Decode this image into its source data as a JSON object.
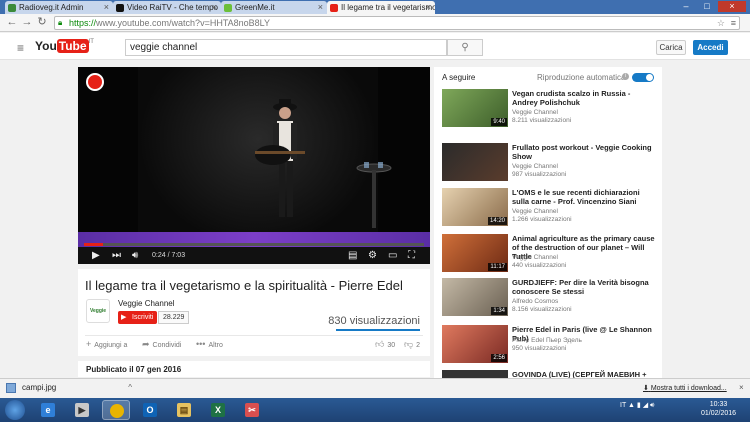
{
  "browser": {
    "tabs": [
      {
        "label": "Radioveg.it Admin",
        "icon_color": "#3a8a3a"
      },
      {
        "label": "Video RaiTV - Che tempo",
        "icon_color": "#111111"
      },
      {
        "label": "GreenMe.it",
        "icon_color": "#6cbf3a"
      },
      {
        "label": "Il legame tra il vegetarismo",
        "icon_color": "#e62117",
        "active": true
      }
    ],
    "url_https": "https://",
    "url_rest": "www.youtube.com/watch?v=HHTA8noB8LY"
  },
  "youtube": {
    "logo_you": "You",
    "logo_tube": "Tube",
    "logo_region": "IT",
    "search_value": "veggie channel",
    "upload_label": "Carica",
    "signin_label": "Accedi"
  },
  "player": {
    "time": "0:24 / 7:03",
    "progress_fraction": 0.057
  },
  "video": {
    "title": "Il legame tra il vegetarismo e la spiritualità - Pierre Edel",
    "channel_name": "Veggie Channel",
    "channel_logo_text": "Veggie",
    "subscribe_label": "Iscriviti",
    "subscriber_count": "28.229",
    "views": "830 visualizzazioni",
    "actions": {
      "add_to": "Aggiungi a",
      "share": "Condividi",
      "more": "Altro",
      "likes": "30",
      "dislikes": "2"
    },
    "published": "Pubblicato il 07 gen 2016"
  },
  "sidebar": {
    "next_label": "A seguire",
    "autoplay_label": "Riproduzione automatica",
    "autoplay_on": true,
    "items": [
      {
        "title": "Vegan crudista scalzo in Russia - Andrey Polishchuk",
        "channel": "Veggie Channel",
        "views": "8.211 visualizzazioni",
        "duration": "9:40",
        "thumb": "#6b8e4e"
      },
      {
        "title": "Frullato post workout - Veggie Cooking Show",
        "channel": "Veggie Channel",
        "views": "987 visualizzazioni",
        "duration": "",
        "thumb": "#3a3a3a"
      },
      {
        "title": "L'OMS e le sue recenti dichiarazioni sulla carne - Prof. Vincenzino Siani",
        "channel": "Veggie Channel",
        "views": "1.266 visualizzazioni",
        "duration": "14:20",
        "thumb": "#c9a77a"
      },
      {
        "title": "Animal agriculture as the primary cause of the destruction of our planet – Will Tuttle",
        "channel": "Veggie Channel",
        "views": "440 visualizzazioni",
        "duration": "11:17",
        "thumb": "#b5562c"
      },
      {
        "title": "GURDJIEFF: Per dire la Verità bisogna conoscere Se stessi",
        "channel": "Alfredo Cosmos",
        "views": "8.156 visualizzazioni",
        "duration": "1:34",
        "thumb": "#9b8f7d"
      },
      {
        "title": "Pierre Edel in Paris (live @ Le Shannon Pub)",
        "channel": "Pierre Edel Пьер Эдель",
        "views": "950 visualizzazioni",
        "duration": "2:56",
        "thumb": "#c4544a"
      },
      {
        "title": "GOVINDA (LIVE) (СЕРГЕЙ МАЕВИН +",
        "channel": "",
        "views": "",
        "duration": "",
        "thumb": "#333333"
      }
    ]
  },
  "downloads": {
    "file": "campi.jpg",
    "show_all": "Mostra tutti i download..."
  },
  "taskbar": {
    "apps": [
      {
        "name": "ie",
        "color": "#2f7fd8",
        "glyph": "e"
      },
      {
        "name": "media",
        "color": "#c8c8c8",
        "glyph": "▶"
      },
      {
        "name": "chrome",
        "color": "#e8b400",
        "glyph": "●",
        "highlight": true
      },
      {
        "name": "outlook",
        "color": "#0f63b5",
        "glyph": "O"
      },
      {
        "name": "explorer",
        "color": "#e6c260",
        "glyph": "▤"
      },
      {
        "name": "excel",
        "color": "#1e7145",
        "glyph": "X"
      },
      {
        "name": "snipping",
        "color": "#d94f4f",
        "glyph": "✂"
      }
    ],
    "lang": "IT",
    "time": "10:33",
    "date": "01/02/2016"
  }
}
